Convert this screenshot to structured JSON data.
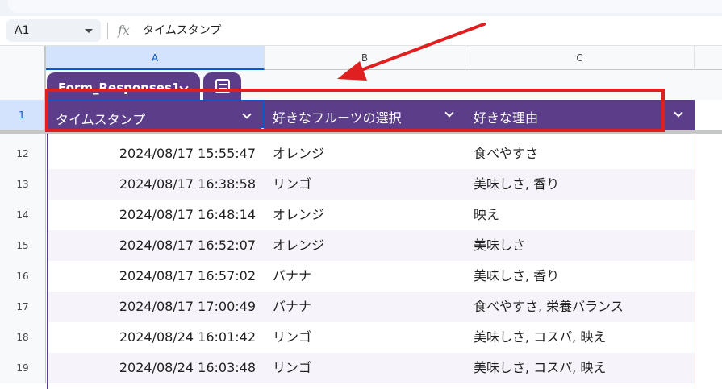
{
  "formula_bar": {
    "name_box": "A1",
    "fx_glyph": "fx",
    "formula": "タイムスタンプ"
  },
  "columns": [
    "A",
    "B",
    "C"
  ],
  "table": {
    "name": "Form_Responses1"
  },
  "header_row": {
    "row_number": "1",
    "cells": [
      "タイムスタンプ",
      "好きなフルーツの選択",
      "好きな理由"
    ]
  },
  "rows": [
    {
      "num": "12",
      "timestamp": "2024/08/17 15:55:47",
      "fruit": "オレンジ",
      "reason": "食べやすさ"
    },
    {
      "num": "13",
      "timestamp": "2024/08/17 16:38:58",
      "fruit": "リンゴ",
      "reason": "美味しさ, 香り"
    },
    {
      "num": "14",
      "timestamp": "2024/08/17 16:48:14",
      "fruit": "オレンジ",
      "reason": "映え"
    },
    {
      "num": "15",
      "timestamp": "2024/08/17 16:52:07",
      "fruit": "オレンジ",
      "reason": "美味しさ"
    },
    {
      "num": "16",
      "timestamp": "2024/08/17 16:57:02",
      "fruit": "バナナ",
      "reason": "美味しさ, 香り"
    },
    {
      "num": "17",
      "timestamp": "2024/08/17 17:00:49",
      "fruit": "バナナ",
      "reason": "食べやすさ, 栄養バランス"
    },
    {
      "num": "18",
      "timestamp": "2024/08/24 16:01:42",
      "fruit": "リンゴ",
      "reason": "美味しさ, コスパ, 映え"
    },
    {
      "num": "19",
      "timestamp": "2024/08/24 16:03:48",
      "fruit": "リンゴ",
      "reason": "美味しさ, コスパ, 映え"
    }
  ],
  "colors": {
    "table_header": "#5b3d8a",
    "selection": "#0b57d0",
    "annotation": "#e02020"
  },
  "icons": {
    "function": "fx-icon",
    "dropdown": "chevron-down-icon",
    "table_menu": "table-menu-icon"
  }
}
